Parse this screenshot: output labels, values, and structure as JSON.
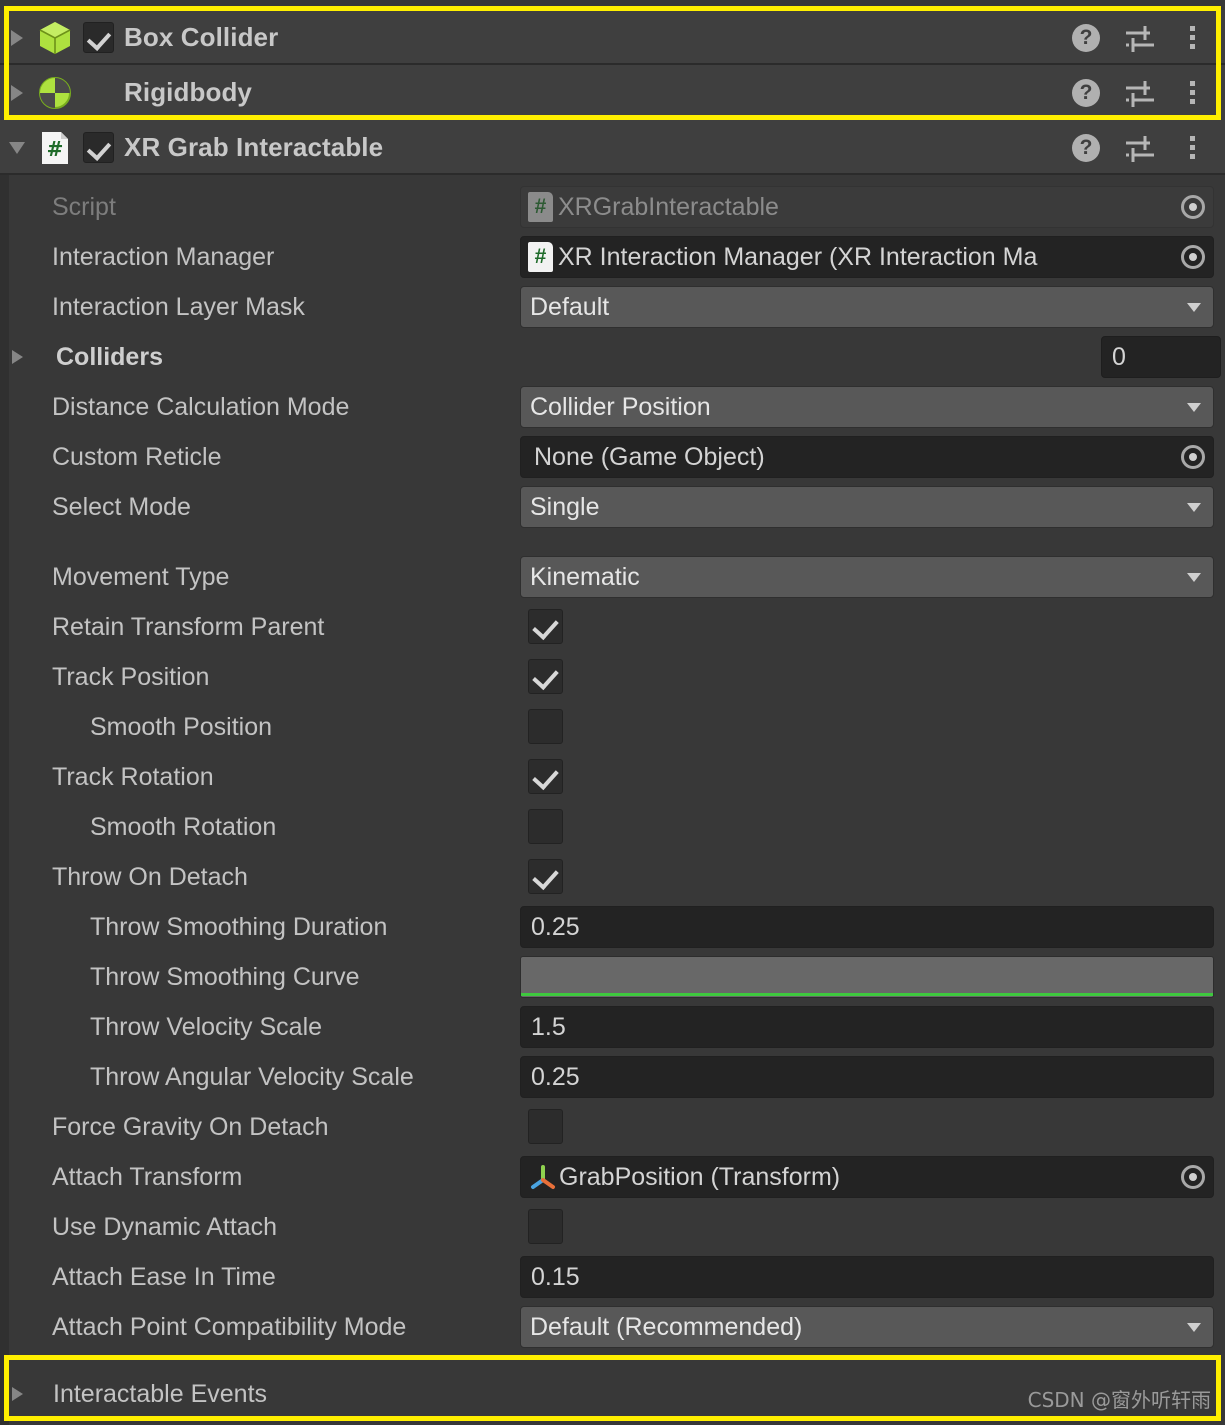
{
  "components": [
    {
      "name": "Box Collider",
      "icon": "box-collider-icon",
      "expanded": false,
      "has_enable_checkbox": true,
      "enabled": true,
      "tools": [
        "help-icon",
        "preset-icon",
        "more-menu-icon"
      ]
    },
    {
      "name": "Rigidbody",
      "icon": "rigidbody-icon",
      "expanded": false,
      "has_enable_checkbox": false,
      "enabled": false,
      "tools": [
        "help-icon",
        "preset-icon",
        "more-menu-icon"
      ]
    },
    {
      "name": "XR Grab Interactable",
      "icon": "script-icon",
      "expanded": true,
      "has_enable_checkbox": true,
      "enabled": true,
      "tools": [
        "help-icon",
        "preset-icon",
        "more-menu-icon"
      ]
    }
  ],
  "properties": [
    {
      "label": "Script",
      "value": "XRGrabInteractable"
    },
    {
      "label": "Interaction Manager",
      "value": "XR Interaction Manager (XR Interaction Ma"
    },
    {
      "label": "Interaction Layer Mask",
      "value": "Default"
    },
    {
      "label": "Colliders",
      "value": "0"
    },
    {
      "label": "Distance Calculation Mode",
      "value": "Collider Position"
    },
    {
      "label": "Custom Reticle",
      "value": "None (Game Object)"
    },
    {
      "label": "Select Mode",
      "value": "Single"
    },
    {
      "label": "Movement Type",
      "value": "Kinematic"
    },
    {
      "label": "Retain Transform Parent",
      "value": "checked"
    },
    {
      "label": "Track Position",
      "value": "checked"
    },
    {
      "label": "Smooth Position",
      "value": "unchecked"
    },
    {
      "label": "Track Rotation",
      "value": "checked"
    },
    {
      "label": "Smooth Rotation",
      "value": "unchecked"
    },
    {
      "label": "Throw On Detach",
      "value": "checked"
    },
    {
      "label": "Throw Smoothing Duration",
      "value": "0.25"
    },
    {
      "label": "Throw Smoothing Curve",
      "value": ""
    },
    {
      "label": "Throw Velocity Scale",
      "value": "1.5"
    },
    {
      "label": "Throw Angular Velocity Scale",
      "value": "0.25"
    },
    {
      "label": "Force Gravity On Detach",
      "value": "unchecked"
    },
    {
      "label": "Attach Transform",
      "value": "GrabPosition (Transform)"
    },
    {
      "label": "Use Dynamic Attach",
      "value": "unchecked"
    },
    {
      "label": "Attach Ease In Time",
      "value": "0.15"
    },
    {
      "label": "Attach Point Compatibility Mode",
      "value": "Default (Recommended)"
    },
    {
      "label": "Interactable Events",
      "value": ""
    }
  ],
  "script_chip_glyph": "#",
  "help_glyph": "?",
  "watermark": "CSDN @窗外听轩雨",
  "colors": {
    "highlight": "#ffef00",
    "panel_bg": "#383838",
    "header_bg": "#3f3f3f",
    "field_dark": "#232323",
    "field_popup": "#585858",
    "unity_green": "#aee13f",
    "curve_line": "#3ec93e"
  }
}
